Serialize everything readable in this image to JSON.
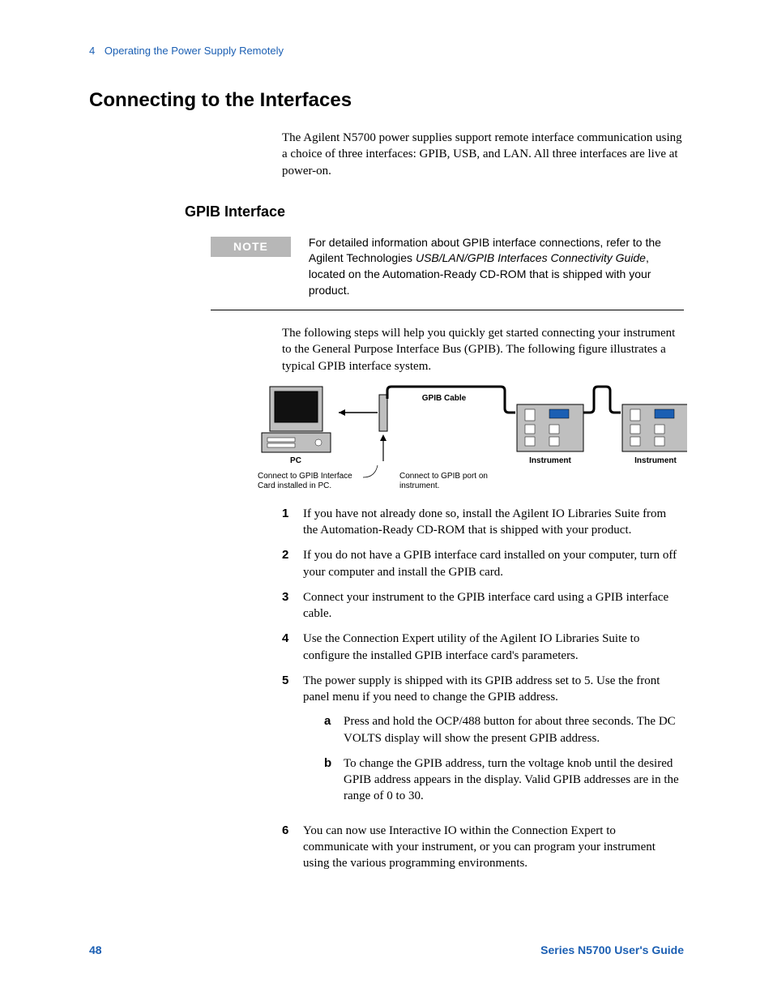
{
  "header": {
    "chapter_num": "4",
    "chapter_title": "Operating the Power Supply Remotely"
  },
  "title": "Connecting to the Interfaces",
  "intro": "The Agilent N5700 power supplies support remote interface communication using a choice of three interfaces: GPIB, USB, and LAN. All three interfaces are live at power-on.",
  "subsection": "GPIB Interface",
  "note": {
    "label": "NOTE",
    "pre": "For detailed information about GPIB interface connections, refer to the Agilent Technologies ",
    "ital": "USB/LAN/GPIB Interfaces Connectivity Guide",
    "post": ", located on the Automation-Ready CD-ROM that is shipped with your product."
  },
  "lead": "The following steps will help you quickly get started connecting your instrument to the General Purpose Interface Bus (GPIB). The following figure illustrates a typical GPIB interface system.",
  "figure": {
    "cable_label": "GPIB Cable",
    "pc_label": "PC",
    "instrument_label_1": "Instrument",
    "instrument_label_2": "Instrument",
    "conn_pc_label": "Connect to GPIB Interface Card  installed in PC.",
    "conn_inst_label": "Connect to GPIB port on instrument."
  },
  "steps": [
    {
      "n": "1",
      "t": "If you have not already done so, install the Agilent IO Libraries Suite from the Automation-Ready CD-ROM that is shipped with your product."
    },
    {
      "n": "2",
      "t": "If you do not have a GPIB interface card installed on your computer, turn off your computer and install the GPIB card."
    },
    {
      "n": "3",
      "t": "Connect your instrument to the GPIB interface card using a GPIB interface cable."
    },
    {
      "n": "4",
      "t": "Use the Connection Expert utility of the Agilent IO Libraries Suite to configure the installed GPIB interface card's parameters."
    },
    {
      "n": "5",
      "t": "The power supply is shipped with its GPIB address set to 5. Use the front panel menu if you need to change the GPIB address.",
      "sub": [
        {
          "n": "a",
          "t": "Press and hold the OCP/488 button for about three seconds. The DC VOLTS display will show the present GPIB address."
        },
        {
          "n": "b",
          "t": "To change the GPIB address, turn the voltage knob until the desired GPIB address appears in the display. Valid GPIB addresses are in the range of 0 to 30."
        }
      ]
    },
    {
      "n": "6",
      "t": "You can now use Interactive IO within the Connection Expert to communicate with your instrument, or you can program your instrument using the various programming environments."
    }
  ],
  "footer": {
    "page": "48",
    "guide": "Series N5700 User's Guide"
  }
}
